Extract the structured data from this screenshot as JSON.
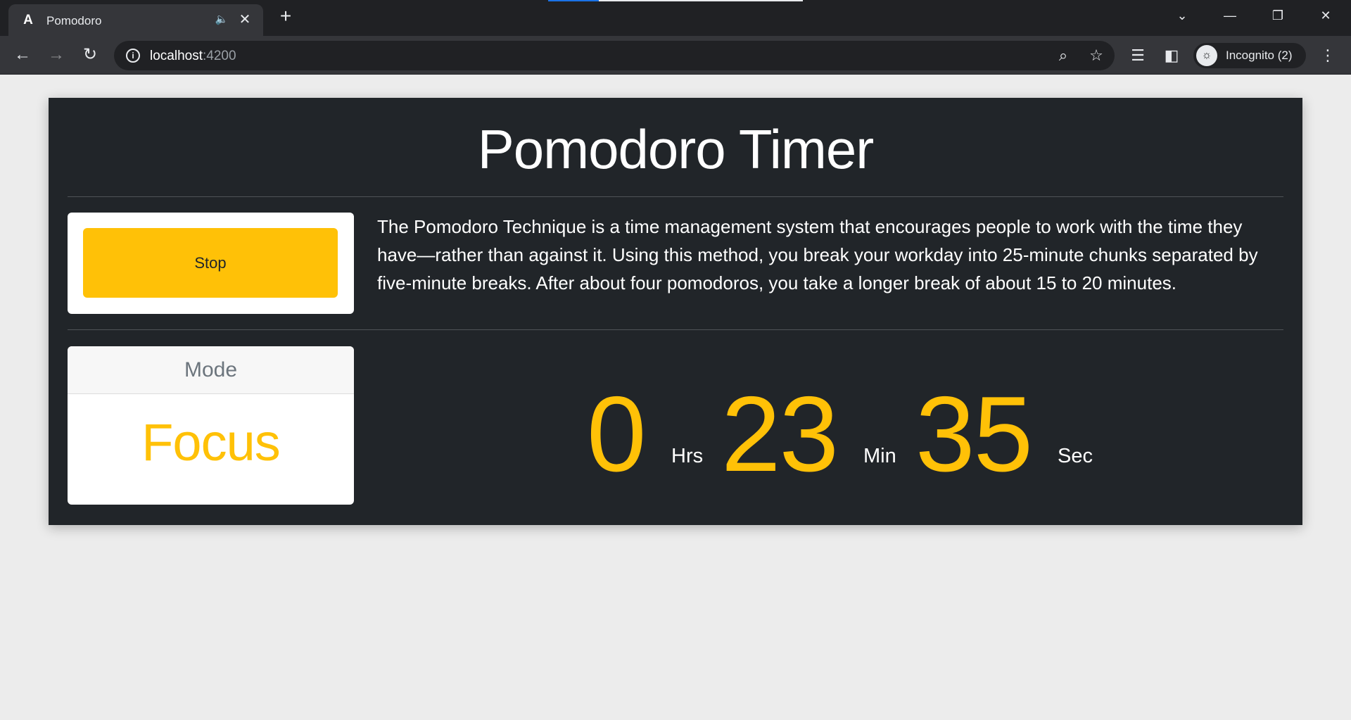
{
  "browser": {
    "tab_title": "Pomodoro",
    "favicon_letter": "A",
    "url_host": "localhost",
    "url_port": ":4200",
    "profile_label": "Incognito (2)",
    "icons": {
      "favicon": "angular-icon",
      "audio": "speaker-icon",
      "close": "close-icon",
      "new_tab": "plus-icon",
      "back": "back-arrow-icon",
      "forward": "forward-arrow-icon",
      "reload": "reload-icon",
      "info": "info-icon",
      "zoom": "zoom-out-icon",
      "bookmark": "star-icon",
      "media": "media-control-icon",
      "side_panel": "side-panel-icon",
      "incognito": "incognito-icon",
      "menu": "kebab-menu-icon",
      "tab_search": "chevron-down-icon",
      "minimize": "minimize-icon",
      "restore": "restore-icon",
      "window_close": "window-close-icon"
    }
  },
  "app": {
    "title": "Pomodoro Timer",
    "control_button_label": "Stop",
    "description": "The Pomodoro Technique is a time management system that encourages people to work with the time they have—rather than against it. Using this method, you break your workday into 25-minute chunks separated by five-minute breaks. After about four pomodoros, you take a longer break of about 15 to 20 minutes.",
    "mode": {
      "header": "Mode",
      "value": "Focus"
    },
    "timer": {
      "hours": "0",
      "hours_unit": "Hrs",
      "minutes": "23",
      "minutes_unit": "Min",
      "seconds": "35",
      "seconds_unit": "Sec"
    }
  },
  "colors": {
    "accent": "#ffc107",
    "card_bg": "#212529",
    "page_bg": "#ececec"
  }
}
